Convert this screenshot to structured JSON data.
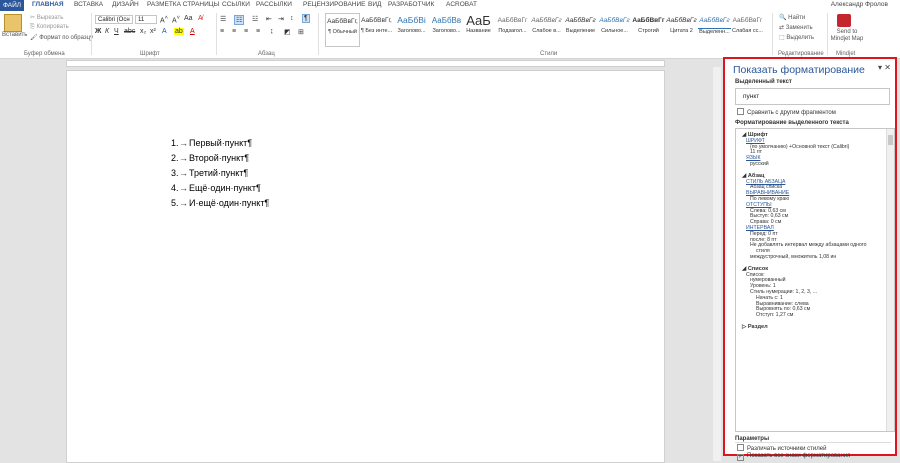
{
  "tabs": [
    "ФАЙЛ",
    "ГЛАВНАЯ",
    "ВСТАВКА",
    "ДИЗАЙН",
    "РАЗМЕТКА СТРАНИЦЫ",
    "ССЫЛКИ",
    "РАССЫЛКИ",
    "РЕЦЕНЗИРОВАНИЕ",
    "ВИД",
    "РАЗРАБОТЧИК",
    "ACROBAT"
  ],
  "user": "Александр Фролов",
  "clipboard": {
    "paste": "Вставить",
    "cut": "Вырезать",
    "copy": "Копировать",
    "format_painter": "Формат по образцу",
    "label": "Буфер обмена"
  },
  "font": {
    "name": "Calibri (Осн",
    "size": "11",
    "label": "Шрифт"
  },
  "paragraph": {
    "label": "Абзац"
  },
  "styles": {
    "label": "Стили",
    "items": [
      {
        "preview": "АаБбВвГг,",
        "name": "¶ Обычный"
      },
      {
        "preview": "АаБбВвГг,",
        "name": "¶ Без инте..."
      },
      {
        "preview": "АаБбВі",
        "name": "Заголово..."
      },
      {
        "preview": "АаБбВв",
        "name": "Заголово..."
      },
      {
        "preview": "АаБ",
        "name": "Название"
      },
      {
        "preview": "АаБбВвГг",
        "name": "Подзагол..."
      },
      {
        "preview": "АаБбВвГг",
        "name": "Слабое в..."
      },
      {
        "preview": "АаБбВвГг",
        "name": "Выделение"
      },
      {
        "preview": "АаБбВвГг",
        "name": "Сильное..."
      },
      {
        "preview": "АаБбВвГг",
        "name": "Строгий"
      },
      {
        "preview": "АаБбВвГг",
        "name": "Цитата 2"
      },
      {
        "preview": "АаБбВвГг",
        "name": "Выделенн..."
      },
      {
        "preview": "АаБбВвГг",
        "name": "Слабая сс..."
      }
    ]
  },
  "editing": {
    "find": "Найти",
    "replace": "Заменить",
    "select": "Выделить",
    "label": "Редактирование"
  },
  "mindjet": {
    "send": "Send to Mindjet Map",
    "label": "Mindjet"
  },
  "document": {
    "items": [
      {
        "num": "1.",
        "text": "Первый·пункт¶"
      },
      {
        "num": "2.",
        "text": "Второй·пункт¶"
      },
      {
        "num": "3.",
        "text": "Третий·пункт¶"
      },
      {
        "num": "4.",
        "text": "Ещё·один·пункт¶"
      },
      {
        "num": "5.",
        "text": "И·ещё·один·пункт¶"
      }
    ]
  },
  "pane": {
    "title": "Показать форматирование",
    "selected_label": "Выделенный текст",
    "selected_value": "пункт",
    "compare": "Сравнить с другим фрагментом",
    "formatting_label": "Форматирование выделенного текста",
    "lines": [
      {
        "t": "Шрифт",
        "k": "sec"
      },
      {
        "t": "ШРИФТ",
        "k": "link"
      },
      {
        "t": "(по умолчанию) +Основной текст (Calibri)",
        "k": "val"
      },
      {
        "t": "11 пт",
        "k": "val"
      },
      {
        "t": "ЯЗЫК",
        "k": "link"
      },
      {
        "t": "русский",
        "k": "val"
      },
      {
        "t": "Абзац",
        "k": "sec"
      },
      {
        "t": "СТИЛЬ АБЗАЦА",
        "k": "link"
      },
      {
        "t": "Абзац списка",
        "k": "val"
      },
      {
        "t": "ВЫРАВНИВАНИЕ",
        "k": "link"
      },
      {
        "t": "По левому краю",
        "k": "val"
      },
      {
        "t": "ОТСТУПЫ",
        "k": "link"
      },
      {
        "t": "Слева: 0,63 см",
        "k": "val"
      },
      {
        "t": "Выступ: 0,63 см",
        "k": "val"
      },
      {
        "t": "Справа: 0 см",
        "k": "val"
      },
      {
        "t": "ИНТЕРВАЛ",
        "k": "link"
      },
      {
        "t": "Перед: 0 пт",
        "k": "val"
      },
      {
        "t": "после: 8 пт",
        "k": "val"
      },
      {
        "t": "Не добавлять интервал между абзацами одного",
        "k": "val"
      },
      {
        "t": "стиля",
        "k": "val2"
      },
      {
        "t": "междустрочный, множитель 1,08 ин",
        "k": "val"
      },
      {
        "t": "Список",
        "k": "sec"
      },
      {
        "t": "Список:",
        "k": "val0"
      },
      {
        "t": "нумерованный",
        "k": "val"
      },
      {
        "t": "Уровень: 1",
        "k": "val"
      },
      {
        "t": "Стиль нумерации:   1, 2, 3, ...",
        "k": "val"
      },
      {
        "t": "Начать с: 1",
        "k": "val2"
      },
      {
        "t": "Выравнивание: слева",
        "k": "val2"
      },
      {
        "t": "Выровнять по: 0,63 см",
        "k": "val2"
      },
      {
        "t": "Отступ:  1,27 см",
        "k": "val2"
      },
      {
        "t": "Раздел",
        "k": "sec"
      }
    ],
    "params_label": "Параметры",
    "opt1": "Различать источники стилей",
    "opt2": "Показать все знаки форматирования"
  }
}
